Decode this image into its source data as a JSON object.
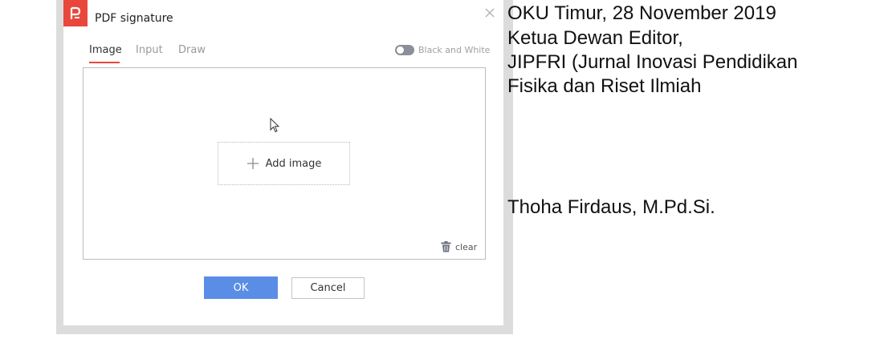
{
  "dialog": {
    "title": "PDF signature",
    "tabs": [
      {
        "label": "Image",
        "active": true
      },
      {
        "label": "Input",
        "active": false
      },
      {
        "label": "Draw",
        "active": false
      }
    ],
    "black_white_label": "Black and White",
    "black_white_on": false,
    "add_image_label": "Add image",
    "clear_label": "clear",
    "ok_label": "OK",
    "cancel_label": "Cancel",
    "colors": {
      "accent": "#e9473c",
      "primary_button": "#5a8de6",
      "toggle": "#8a8f99"
    },
    "icons": [
      "pdf-app-icon",
      "close-icon",
      "plus-icon",
      "trash-icon",
      "mouse-cursor-icon"
    ]
  },
  "document": {
    "lines": [
      "OKU Timur, 28 November 2019",
      "Ketua Dewan Editor,",
      "JIPFRI (Jurnal Inovasi Pendidikan",
      "Fisika dan Riset Ilmiah"
    ],
    "signer": "Thoha Firdaus, M.Pd.Si."
  }
}
